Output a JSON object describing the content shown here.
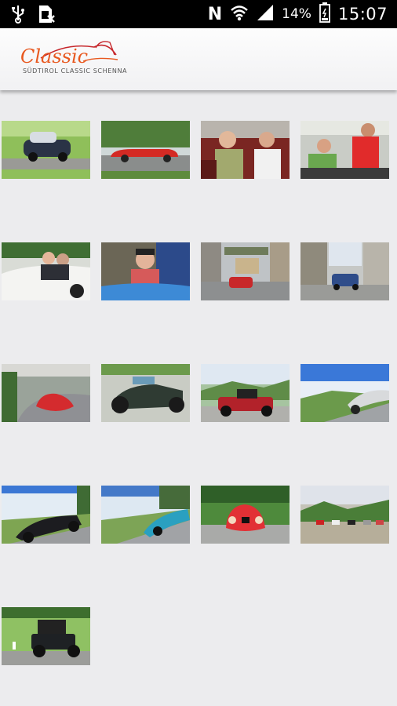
{
  "status_bar": {
    "battery_percent": "14%",
    "time": "15:07",
    "icons": [
      "usb-icon",
      "sim-card-icon",
      "nfc-icon",
      "wifi-icon",
      "signal-icon",
      "battery-icon"
    ]
  },
  "header": {
    "logo_script": "Classic",
    "logo_tagline": "SÜDTIROL CLASSIC SCHENNA",
    "colors": {
      "logo_orange": "#e8581f",
      "logo_red": "#c6262b"
    }
  },
  "gallery": {
    "photos": [
      {
        "subject": "dark convertible on grass"
      },
      {
        "subject": "red roadster on mountain road"
      },
      {
        "subject": "two drivers in car"
      },
      {
        "subject": "man in red shirt and driver"
      },
      {
        "subject": "drivers in white convertible"
      },
      {
        "subject": "driver with goggles in blue car"
      },
      {
        "subject": "red car in town street"
      },
      {
        "subject": "blue car in town street"
      },
      {
        "subject": "red car on curve"
      },
      {
        "subject": "dark green roadster"
      },
      {
        "subject": "red and black vintage car"
      },
      {
        "subject": "silver car on mountain road"
      },
      {
        "subject": "black roadster on road"
      },
      {
        "subject": "blue sports car"
      },
      {
        "subject": "red race car front"
      },
      {
        "subject": "cars parked on meadow"
      },
      {
        "subject": "black vintage car on grass"
      }
    ]
  }
}
